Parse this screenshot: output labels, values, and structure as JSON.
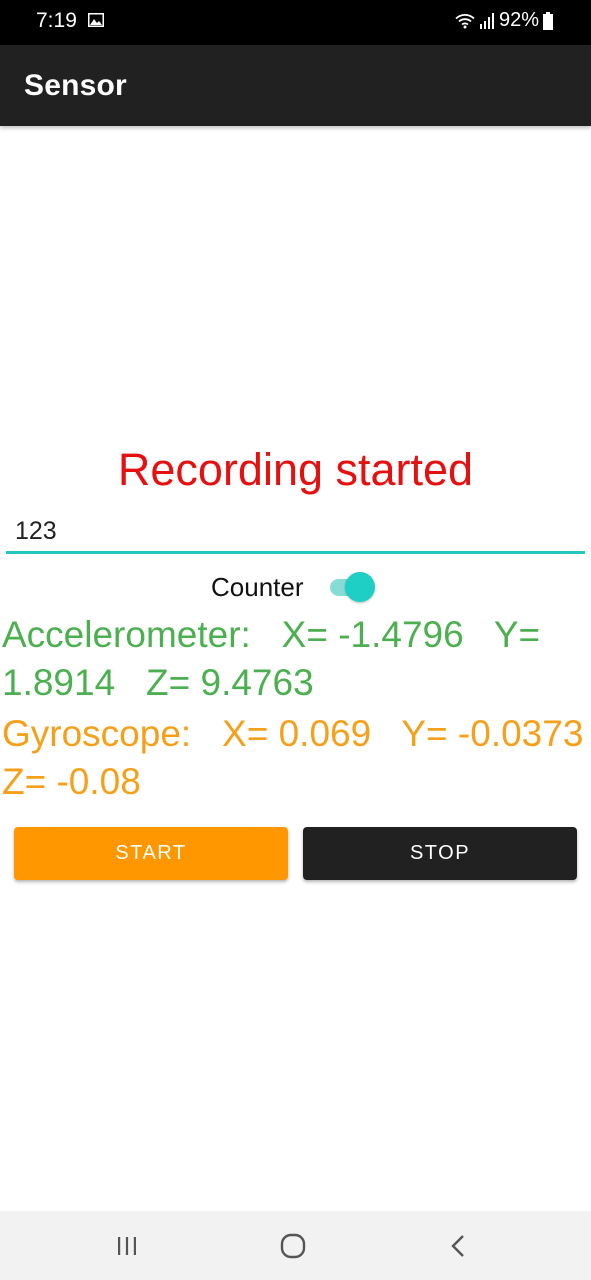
{
  "status_bar": {
    "time": "7:19",
    "battery": "92%",
    "icons": [
      "gallery-icon",
      "wifi-icon",
      "signal-icon",
      "battery-icon"
    ]
  },
  "app_bar": {
    "title": "Sensor"
  },
  "recording_status": "Recording started",
  "input": {
    "value": "123"
  },
  "counter": {
    "label": "Counter",
    "enabled": true
  },
  "accelerometer": {
    "text": "Accelerometer:   X= -1.4796   Y= 1.8914   Z= 9.4763"
  },
  "gyroscope": {
    "text": "Gyroscope:   X= 0.069   Y= -0.0373   Z= -0.08"
  },
  "buttons": {
    "start": "START",
    "stop": "STOP"
  },
  "colors": {
    "app_bar": "#212121",
    "recording_status": "#e51010",
    "accelerometer": "#4caf50",
    "gyroscope": "#f5a01a",
    "start_button": "#ff9800",
    "stop_button": "#212121",
    "accent": "#1dcfc5"
  },
  "nav_bar": {
    "icons": [
      "recents-icon",
      "home-icon",
      "back-icon"
    ]
  }
}
